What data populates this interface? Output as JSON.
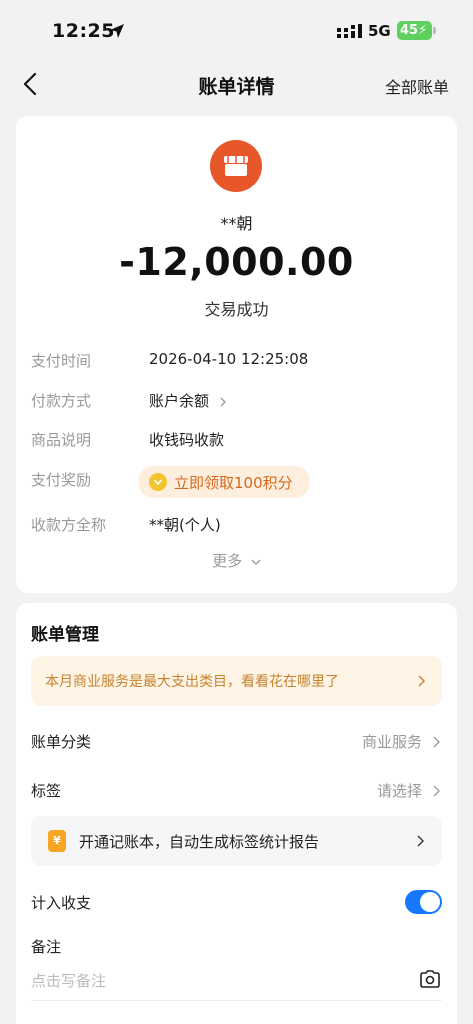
{
  "status_bar": {
    "time": "12:25",
    "network": "5G",
    "battery": "45"
  },
  "nav": {
    "title": "账单详情",
    "right_link": "全部账单"
  },
  "transaction": {
    "merchant": "**朝",
    "amount": "-12,000.00",
    "status": "交易成功",
    "details": [
      {
        "label": "支付时间",
        "value": "2026-04-10 12:25:08"
      },
      {
        "label": "付款方式",
        "value": "账户余额"
      },
      {
        "label": "商品说明",
        "value": "收钱码收款"
      },
      {
        "label": "支付奖励",
        "value": "立即领取100积分"
      },
      {
        "label": "收款方全称",
        "value": "**朝(个人)"
      }
    ],
    "more": "更多"
  },
  "management": {
    "title": "账单管理",
    "tip": "本月商业服务是最大支出类目，看看花在哪里了",
    "category_label": "账单分类",
    "category_value": "商业服务",
    "tag_label": "标签",
    "tag_value": "请选择",
    "promo_icon": "¥",
    "promo": "开通记账本，自动生成标签统计报告",
    "count_label": "计入收支",
    "count_enabled": true,
    "note_label": "备注",
    "note_placeholder": "点击写备注"
  },
  "colors": {
    "accent": "#1677ff",
    "merchant_icon": "#e8572a",
    "reward": "#d46a1f",
    "tip": "#c8822e"
  }
}
